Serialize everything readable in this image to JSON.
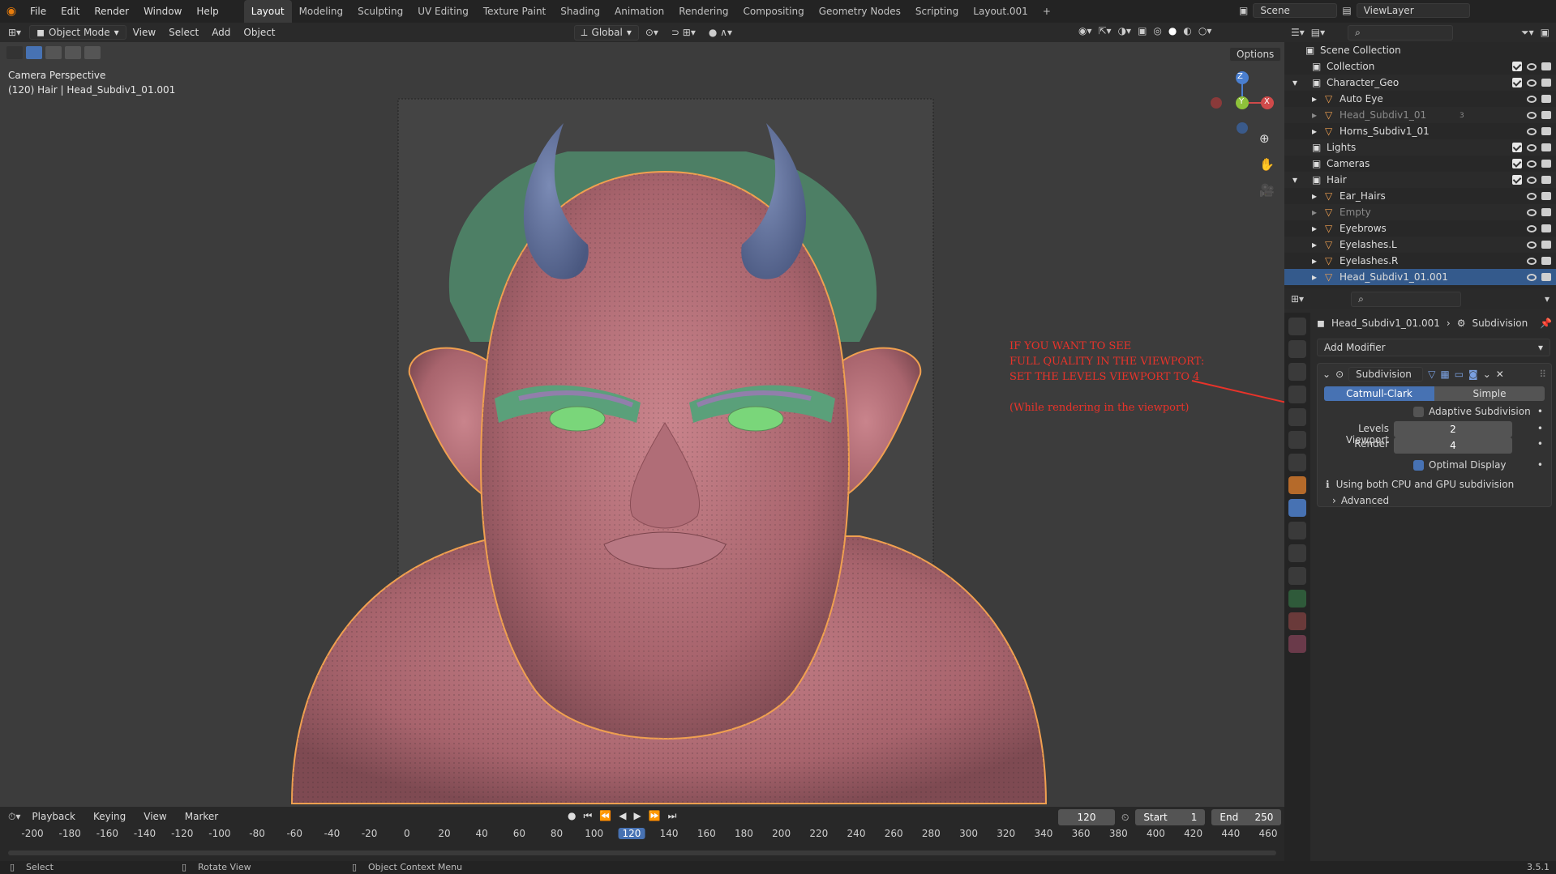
{
  "topbar": {
    "menus": [
      "File",
      "Edit",
      "Render",
      "Window",
      "Help"
    ],
    "workspaces": [
      "Layout",
      "Modeling",
      "Sculpting",
      "UV Editing",
      "Texture Paint",
      "Shading",
      "Animation",
      "Rendering",
      "Compositing",
      "Geometry Nodes",
      "Scripting",
      "Layout.001"
    ],
    "active_workspace": "Layout",
    "add_workspace": "+",
    "scene": "Scene",
    "view_layer": "ViewLayer"
  },
  "viewport_header": {
    "mode": "Object Mode",
    "menus": [
      "View",
      "Select",
      "Add",
      "Object"
    ],
    "transform_orientation": "Global",
    "options": "Options"
  },
  "viewport": {
    "camera_label": "Camera Perspective",
    "object_info": "(120) Hair | Head_Subdiv1_01.001",
    "gizmo_axes": [
      "Z",
      "Y",
      "X"
    ]
  },
  "annotation": {
    "lines": [
      "IF YOU WANT TO SEE",
      "FULL QUALITY IN THE VIEWPORT:",
      "SET THE LEVELS VIEWPORT TO 4"
    ],
    "note": "(While rendering in the viewport)",
    "color": "#e8332a"
  },
  "outliner": {
    "root": "Scene Collection",
    "rows": [
      {
        "label": "Collection",
        "indent": 0
      },
      {
        "label": "Character_Geo",
        "indent": 0
      },
      {
        "label": "Auto Eye",
        "indent": 1
      },
      {
        "label": "Head_Subdiv1_01",
        "indent": 1
      },
      {
        "label": "Horns_Subdiv1_01",
        "indent": 1
      },
      {
        "label": "Lights",
        "indent": 0
      },
      {
        "label": "Cameras",
        "indent": 0
      },
      {
        "label": "Hair",
        "indent": 0
      },
      {
        "label": "Ear_Hairs",
        "indent": 1
      },
      {
        "label": "Empty",
        "indent": 1
      },
      {
        "label": "Eyebrows",
        "indent": 1
      },
      {
        "label": "Eyelashes.L",
        "indent": 1
      },
      {
        "label": "Eyelashes.R",
        "indent": 1
      },
      {
        "label": "Head_Subdiv1_01.001",
        "indent": 1
      }
    ],
    "badge_3": "3"
  },
  "properties": {
    "breadcrumb_object": "Head_Subdiv1_01.001",
    "breadcrumb_modifier": "Subdivision",
    "add_modifier": "Add Modifier",
    "modifier_name": "Subdivision",
    "type_catmull": "Catmull-Clark",
    "type_simple": "Simple",
    "adaptive": "Adaptive Subdivision",
    "levels_viewport_label": "Levels Viewport",
    "levels_viewport_value": "2",
    "render_label": "Render",
    "render_value": "4",
    "optimal_display": "Optimal Display",
    "info": "Using both CPU and GPU subdivision",
    "advanced": "Advanced"
  },
  "timeline": {
    "menus": [
      "Playback",
      "Keying",
      "View",
      "Marker"
    ],
    "current_frame": "120",
    "start_label": "Start",
    "start_value": "1",
    "end_label": "End",
    "end_value": "250",
    "ticks": [
      "-200",
      "-180",
      "-160",
      "-140",
      "-120",
      "-100",
      "-80",
      "-60",
      "-40",
      "-20",
      "0",
      "20",
      "40",
      "60",
      "80",
      "100",
      "120",
      "140",
      "160",
      "180",
      "200",
      "220",
      "240",
      "260",
      "280",
      "300",
      "320",
      "340",
      "360",
      "380",
      "400",
      "420",
      "440",
      "460"
    ]
  },
  "statusbar": {
    "select": "Select",
    "rotate": "Rotate View",
    "context": "Object Context Menu",
    "version": "3.5.1"
  },
  "colors": {
    "accent": "#4772b3",
    "selection": "#f0a050",
    "skin": "#b9707a",
    "horn": "#5a6a93",
    "hair": "#5aa07a",
    "eye": "#7ad67a"
  }
}
